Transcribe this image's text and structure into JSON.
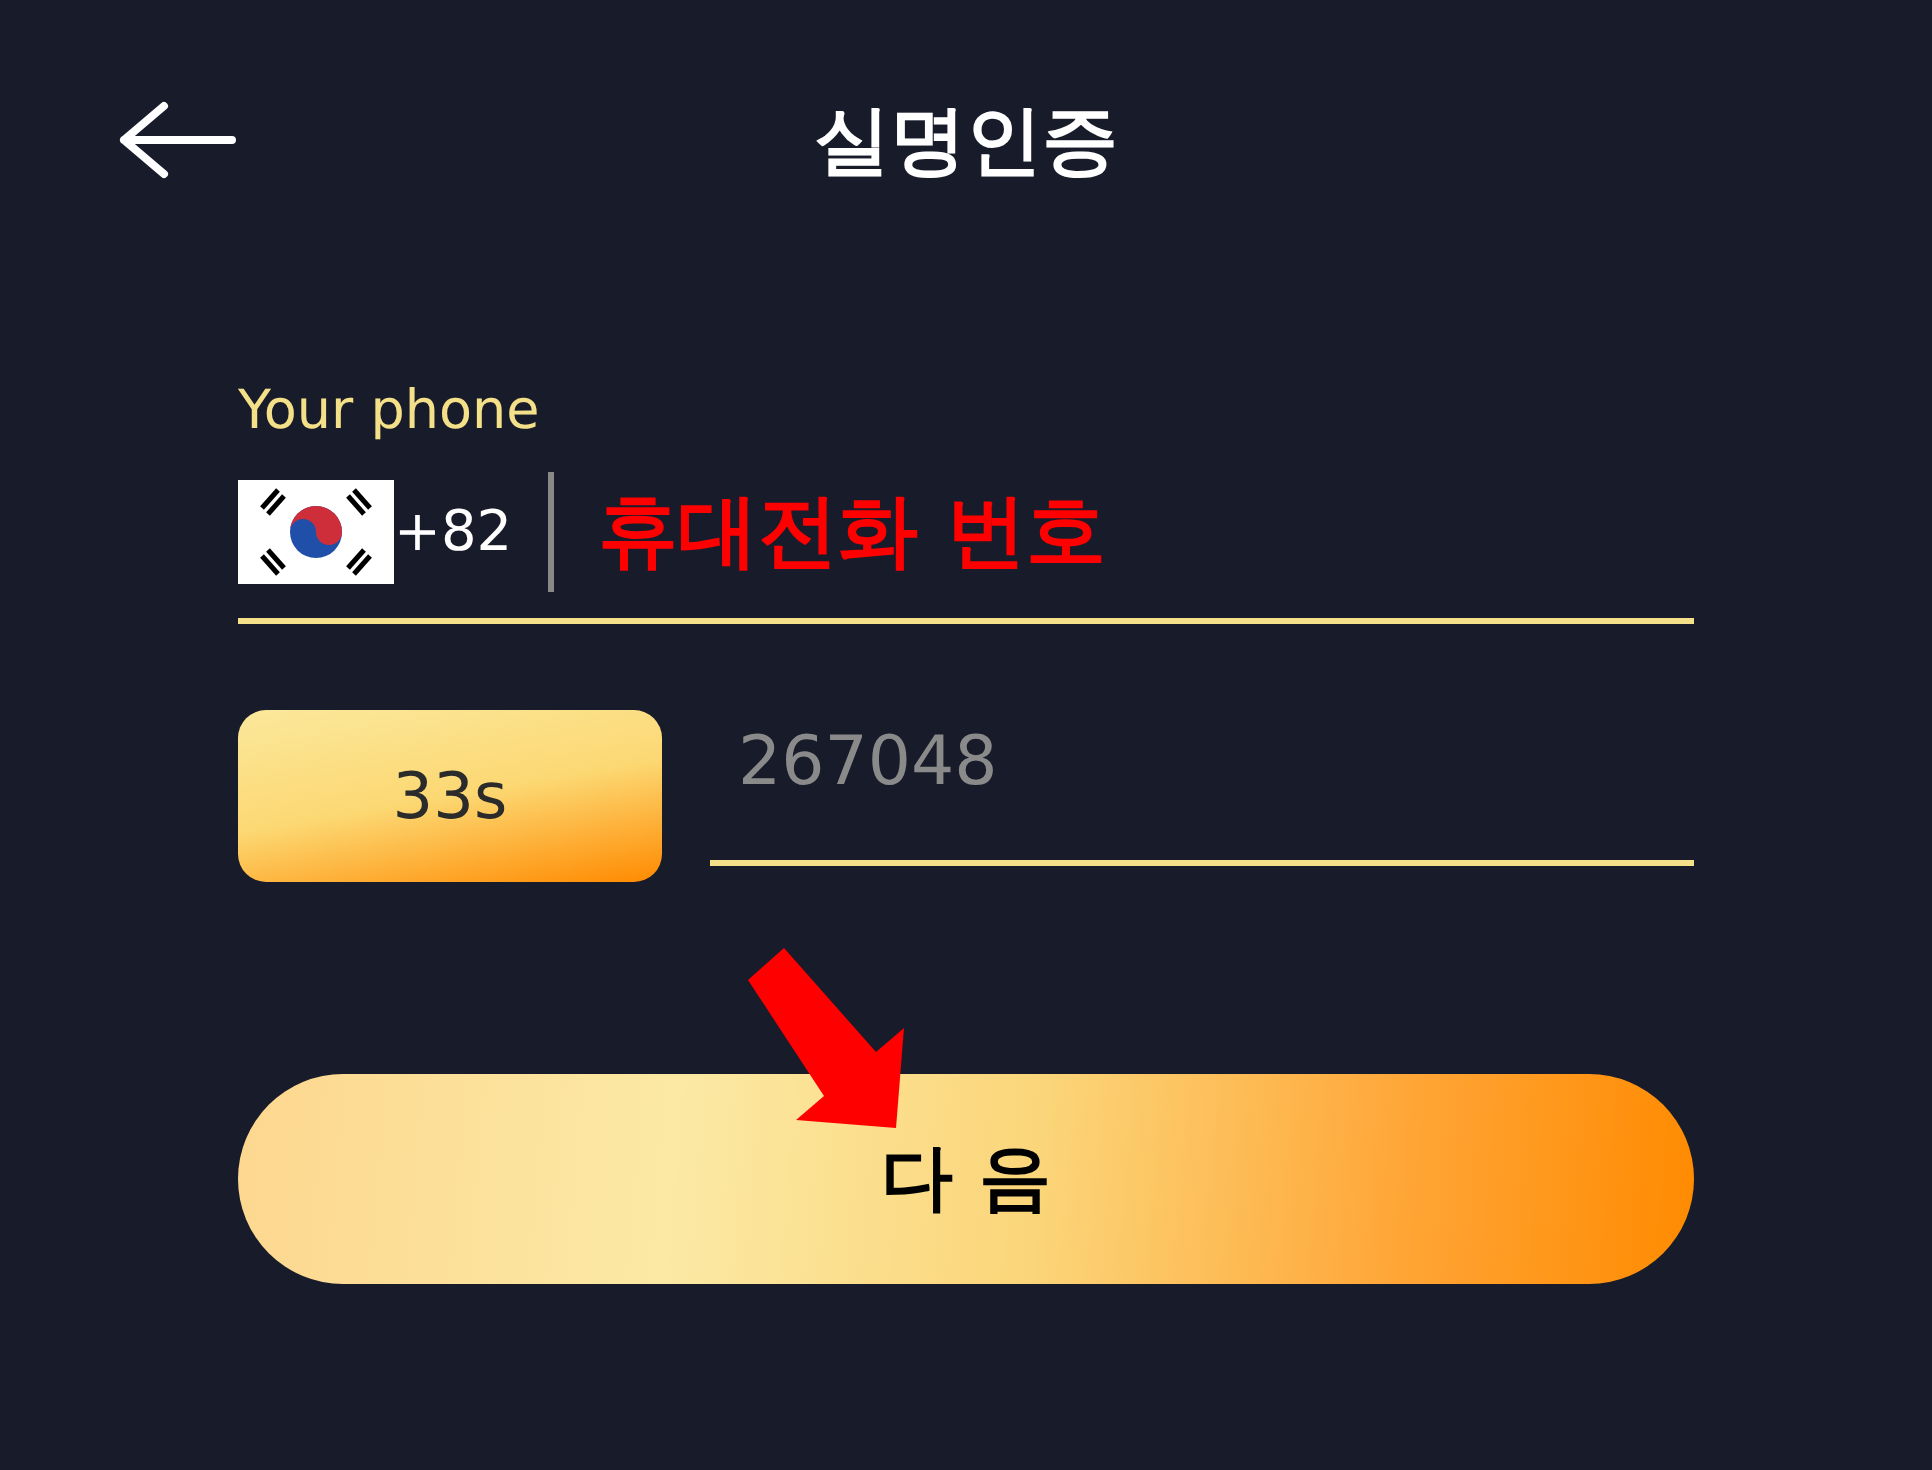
{
  "header": {
    "title": "실명인증"
  },
  "phone": {
    "label": "Your phone",
    "country_code": "+82",
    "annotation": "휴대전화 번호"
  },
  "code": {
    "timer": "33s",
    "placeholder": "267048"
  },
  "next_button": {
    "label": "다 음"
  }
}
